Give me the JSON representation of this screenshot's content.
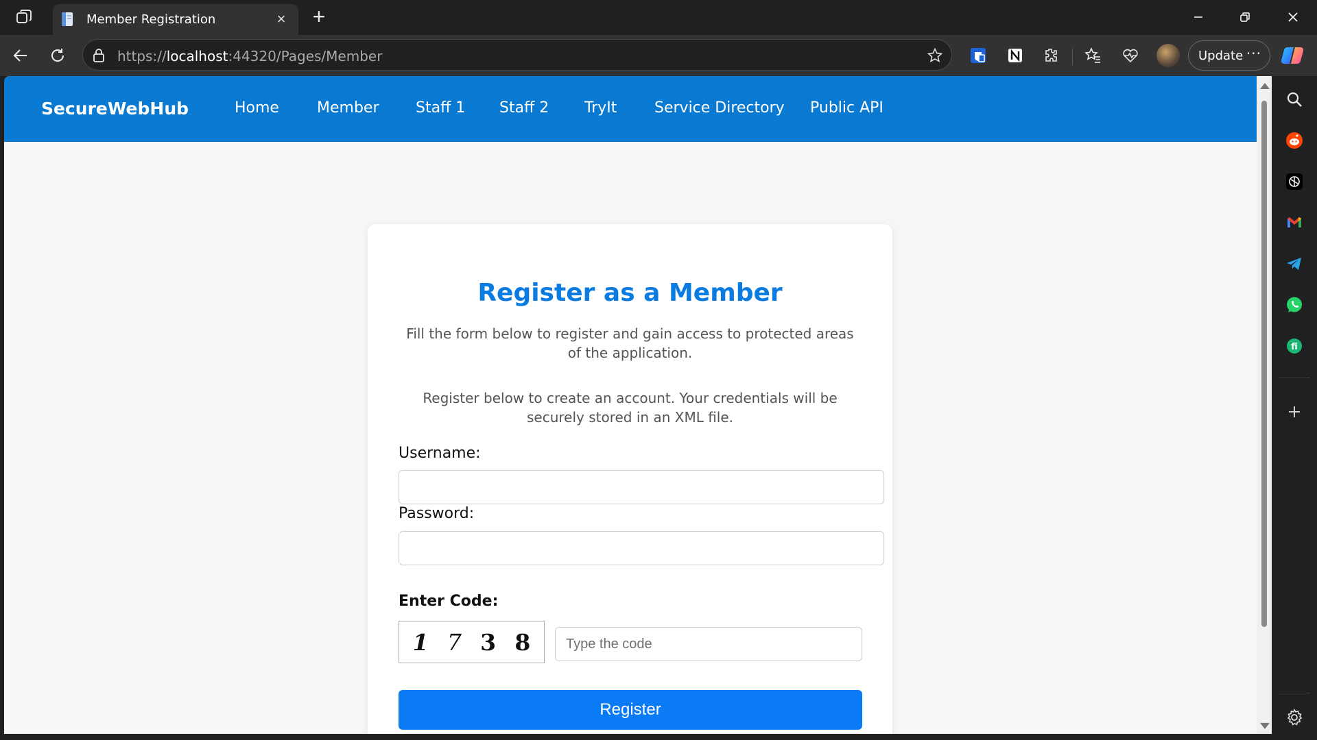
{
  "browser": {
    "tab_title": "Member Registration",
    "url_scheme": "https://",
    "url_host": "localhost",
    "url_rest": ":44320/Pages/Member",
    "update_label": "Update",
    "more_label": "···"
  },
  "site": {
    "brand": "SecureWebHub",
    "nav": [
      "Home",
      "Member",
      "Staff 1",
      "Staff 2",
      "TryIt",
      "Service Directory",
      "Public API"
    ]
  },
  "form": {
    "title": "Register as a Member",
    "description_1": "Fill the form below to register and gain access to protected areas of the application.",
    "description_2": "Register below to create an account. Your credentials will be securely stored in an XML file.",
    "username_label": "Username:",
    "username_value": "",
    "password_label": "Password:",
    "password_value": "",
    "code_label": "Enter Code:",
    "captcha_digits": [
      "1",
      "7",
      "3",
      "8"
    ],
    "code_placeholder": "Type the code",
    "register_label": "Register"
  },
  "colors": {
    "nav_bar": "#0a79d1",
    "title": "#0a7be0",
    "button": "#0a7af5"
  }
}
